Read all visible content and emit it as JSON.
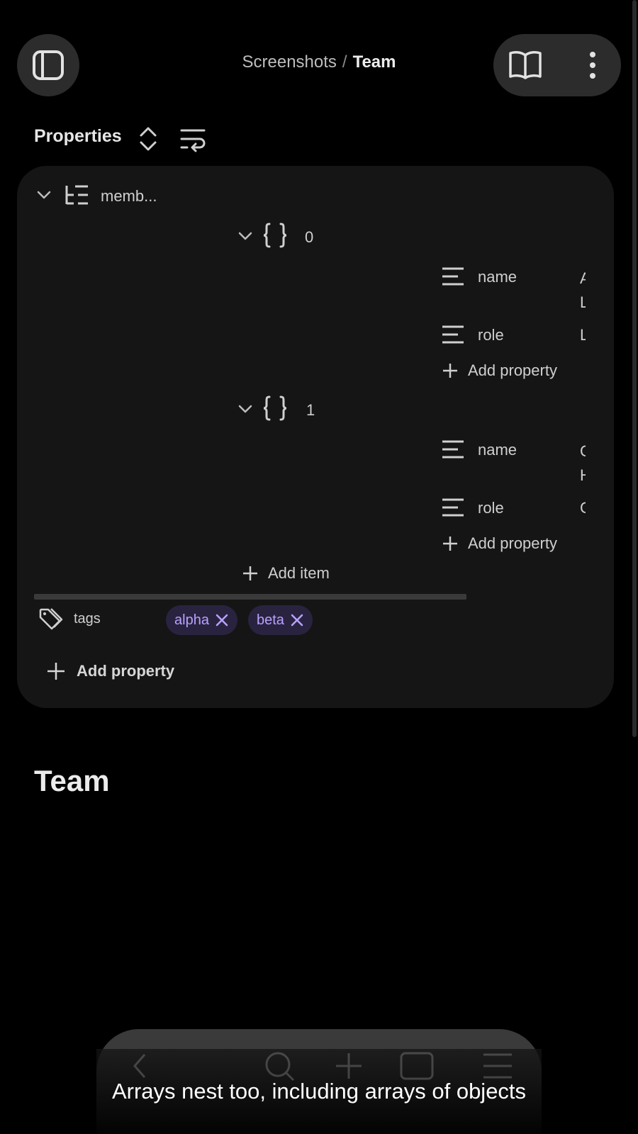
{
  "header": {
    "breadcrumb_parent": "Screenshots",
    "breadcrumb_separator": "/",
    "breadcrumb_current": "Team",
    "left_icon": "sidebar-toggle-icon",
    "reading_icon": "book-icon",
    "menu_icon": "more-vertical-icon"
  },
  "properties": {
    "title": "Properties",
    "sort_icon": "chevron-up-down-icon",
    "wrap_icon": "wrap-text-icon",
    "members": {
      "label": "memb...",
      "items": [
        {
          "index": "0",
          "fields": [
            {
              "key": "name",
              "value": "A L"
            },
            {
              "key": "role",
              "value": "L"
            }
          ],
          "add_property_label": "Add property"
        },
        {
          "index": "1",
          "fields": [
            {
              "key": "name",
              "value": "C H"
            },
            {
              "key": "role",
              "value": "C"
            }
          ],
          "add_property_label": "Add property"
        }
      ],
      "add_item_label": "Add item"
    },
    "tags": {
      "label": "tags",
      "values": [
        "alpha",
        "beta"
      ]
    },
    "add_property_label": "Add property"
  },
  "page": {
    "title": "Team"
  },
  "caption": "Arrays nest too, including arrays of objects",
  "colors": {
    "background": "#000000",
    "card": "#151515",
    "tag_bg": "#2a2340",
    "tag_text": "#b7a2ff"
  }
}
